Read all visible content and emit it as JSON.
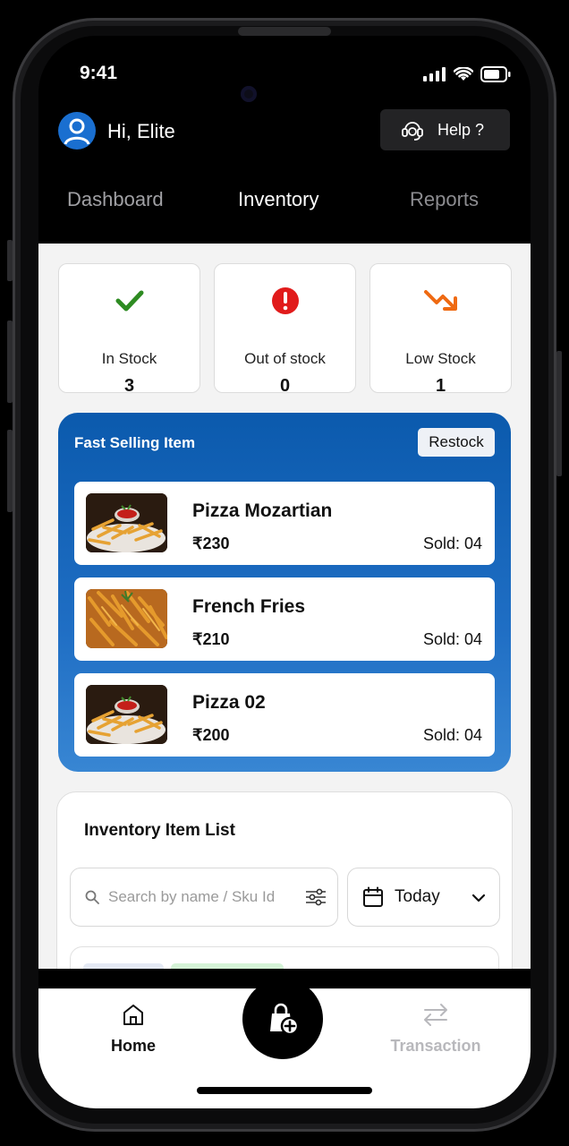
{
  "status_bar": {
    "time": "9:41"
  },
  "header": {
    "greeting": "Hi, Elite",
    "help_label": "Help ?"
  },
  "tabs": [
    {
      "label": "Dashboard"
    },
    {
      "label": "Inventory"
    },
    {
      "label": "Reports"
    }
  ],
  "stats": [
    {
      "label": "In Stock",
      "value": "3",
      "icon": "checkmark-icon",
      "color": "#2e8b22"
    },
    {
      "label": "Out of stock",
      "value": "0",
      "icon": "alert-circle-icon",
      "color": "#e11b1b"
    },
    {
      "label": "Low Stock",
      "value": "1",
      "icon": "trending-down-icon",
      "color": "#ef6a12"
    }
  ],
  "fast_selling": {
    "title": "Fast Selling Item",
    "restock_label": "Restock",
    "items": [
      {
        "name": "Pizza Mozartian",
        "price": "₹230",
        "sold": "Sold: 04"
      },
      {
        "name": "French Fries",
        "price": "₹210",
        "sold": "Sold: 04"
      },
      {
        "name": "Pizza 02",
        "price": "₹200",
        "sold": "Sold: 04"
      }
    ]
  },
  "inventory_list": {
    "title": "Inventory Item List",
    "search_placeholder": "Search by name / Sku Id",
    "date_filter": "Today"
  },
  "bottom_nav": {
    "home_label": "Home",
    "transaction_label": "Transaction"
  },
  "colors": {
    "accent_blue": "#0b5aad",
    "avatar_blue": "#1a6fd0"
  }
}
